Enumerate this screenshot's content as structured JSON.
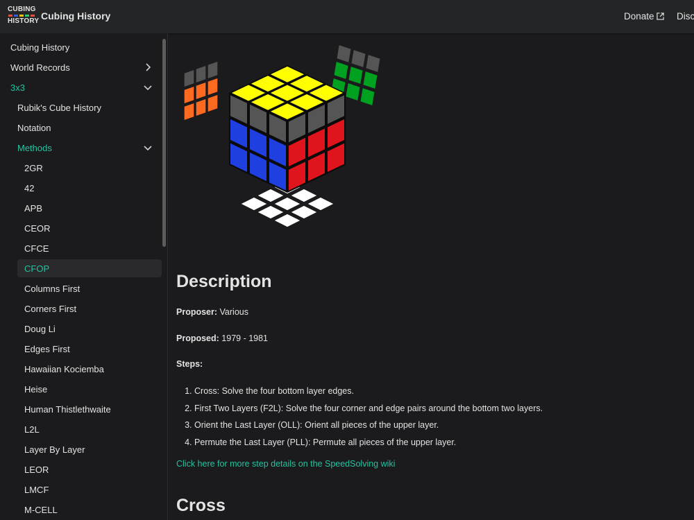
{
  "navbar": {
    "logo_top": "CUBING",
    "logo_bottom": "HISTORY",
    "brand": "Cubing History",
    "donate": "Donate",
    "disc": "Disc",
    "logo_colors": [
      "#e74c3c",
      "#3b5bdb",
      "#f1c40f",
      "#2ecc71",
      "#ffffff"
    ]
  },
  "sidebar": {
    "items": [
      {
        "label": "Cubing History"
      },
      {
        "label": "World Records"
      },
      {
        "label": "3x3"
      },
      {
        "label": "Rubik's Cube History"
      },
      {
        "label": "Notation"
      },
      {
        "label": "Methods"
      },
      {
        "label": "2GR"
      },
      {
        "label": "42"
      },
      {
        "label": "APB"
      },
      {
        "label": "CEOR"
      },
      {
        "label": "CFCE"
      },
      {
        "label": "CFOP"
      },
      {
        "label": "Columns First"
      },
      {
        "label": "Corners First"
      },
      {
        "label": "Doug Li"
      },
      {
        "label": "Edges First"
      },
      {
        "label": "Hawaiian Kociemba"
      },
      {
        "label": "Heise"
      },
      {
        "label": "Human Thistlethwaite"
      },
      {
        "label": "L2L"
      },
      {
        "label": "Layer By Layer"
      },
      {
        "label": "LEOR"
      },
      {
        "label": "LMCF"
      },
      {
        "label": "M-CELL"
      }
    ]
  },
  "main": {
    "description_heading": "Description",
    "proposer_label": "Proposer:",
    "proposer_value": " Various",
    "proposed_label": "Proposed:",
    "proposed_value": " 1979 - 1981",
    "steps_label": "Steps:",
    "steps": [
      "Cross: Solve the four bottom layer edges.",
      "First Two Layers (F2L): Solve the four corner and edge pairs around the bottom two layers.",
      "Orient the Last Layer (OLL): Orient all pieces of the upper layer.",
      "Permute the Last Layer (PLL): Permute all pieces of the upper layer."
    ],
    "more_link": "Click here for more step details on the SpeedSolving wiki",
    "cross_heading": "Cross"
  },
  "colors": {
    "accent": "#25c2a0",
    "yellow": "#ffff00",
    "blue": "#1f3fe0",
    "red": "#e0141c",
    "orange": "#ff6a21",
    "green": "#00a020",
    "gray": "#555555",
    "white": "#ffffff"
  }
}
